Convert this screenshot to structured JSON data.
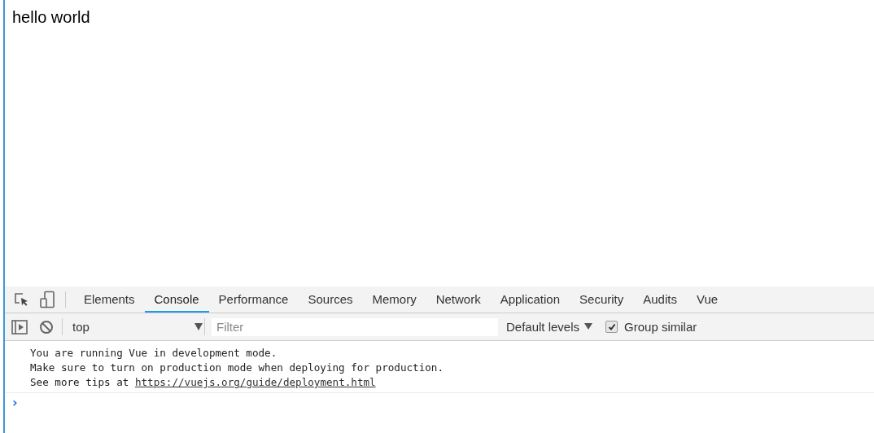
{
  "page": {
    "heading": "hello world"
  },
  "devtools": {
    "tabs": [
      {
        "label": "Elements",
        "selected": false
      },
      {
        "label": "Console",
        "selected": true
      },
      {
        "label": "Performance",
        "selected": false
      },
      {
        "label": "Sources",
        "selected": false
      },
      {
        "label": "Memory",
        "selected": false
      },
      {
        "label": "Network",
        "selected": false
      },
      {
        "label": "Application",
        "selected": false
      },
      {
        "label": "Security",
        "selected": false
      },
      {
        "label": "Audits",
        "selected": false
      },
      {
        "label": "Vue",
        "selected": false
      }
    ],
    "context": "top",
    "filter": {
      "placeholder": "Filter"
    },
    "levels": "Default levels",
    "group_similar": {
      "label": "Group similar",
      "checked": true
    },
    "messages": [
      {
        "text": "You are running Vue in development mode."
      },
      {
        "text": "Make sure to turn on production mode when deploying for production."
      },
      {
        "text": "See more tips at",
        "link": "https://vuejs.org/guide/deployment.html"
      }
    ],
    "prompt": "›"
  }
}
